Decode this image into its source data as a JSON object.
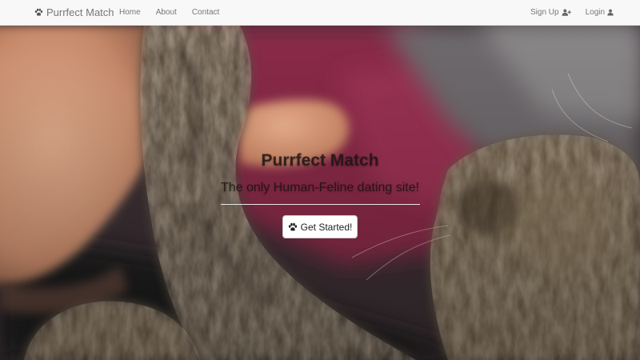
{
  "navbar": {
    "brand": {
      "label": "Purrfect Match",
      "icon": "paw-icon"
    },
    "left_links": [
      {
        "label": "Home"
      },
      {
        "label": "About"
      },
      {
        "label": "Contact"
      }
    ],
    "right_links": [
      {
        "label": "Sign Up",
        "icon": "user-plus-icon"
      },
      {
        "label": "Login",
        "icon": "user-icon"
      }
    ],
    "background": "#f8f8f8",
    "link_color": "#777777"
  },
  "hero": {
    "title": "Purrfect Match",
    "subtitle": "The only Human-Feline dating site!",
    "cta_label": "Get Started!",
    "cta_icon": "paw-icon",
    "background_image": "human-hand-touching-cat-paw-photo"
  }
}
